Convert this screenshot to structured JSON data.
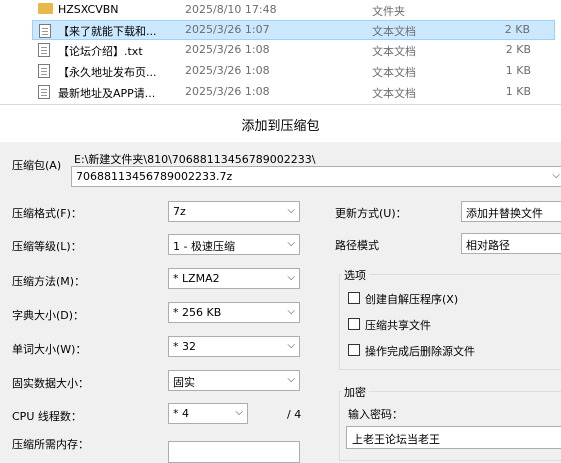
{
  "files": [
    {
      "name": "HZSXCVBN",
      "date": "2025/8/10 17:48",
      "type": "文件夹",
      "size": "",
      "icon": "folder-icon"
    },
    {
      "name": "【来了就能下载和...",
      "date": "2025/3/26 1:07",
      "type": "文本文档",
      "size": "2 KB",
      "icon": "document-icon"
    },
    {
      "name": "【论坛介绍】.txt",
      "date": "2025/3/26 1:08",
      "type": "文本文档",
      "size": "2 KB",
      "icon": "document-icon"
    },
    {
      "name": "【永久地址发布页...",
      "date": "2025/3/26 1:08",
      "type": "文本文档",
      "size": "1 KB",
      "icon": "document-icon"
    },
    {
      "name": "最新地址及APP请...",
      "date": "2025/3/26 1:08",
      "type": "文本文档",
      "size": "1 KB",
      "icon": "document-icon"
    }
  ],
  "dialog": {
    "title": "添加到压缩包",
    "archive_label": "压缩包(A)",
    "archive_path": "E:\\新建文件夹\\810\\70688113456789002233\\",
    "archive_name": "70688113456789002233.7z",
    "format_label": "压缩格式(F)：",
    "format_value": "7z",
    "level_label": "压缩等级(L)：",
    "level_value": "1 - 极速压缩",
    "method_label": "压缩方法(M)：",
    "method_value": "*  LZMA2",
    "dict_label": "字典大小(D)：",
    "dict_value": "*  256 KB",
    "word_label": "单词大小(W)：",
    "word_value": "*  32",
    "solid_label": "固实数据大小：",
    "solid_value": "固实",
    "threads_label": "CPU 线程数：",
    "threads_value": "*  4",
    "threads_total": "/ 4",
    "memory_label": "压缩所需内存：",
    "update_label": "更新方式(U)：",
    "update_value": "添加并替换文件",
    "path_label": "路径模式",
    "path_value": "相对路径",
    "options_title": "选项",
    "opt_sfx": "创建自解压程序(X)",
    "opt_shared": "压缩共享文件",
    "opt_delete": "操作完成后删除源文件",
    "encrypt_title": "加密",
    "password_label": "输入密码：",
    "password_value": "上老王论坛当老王"
  }
}
